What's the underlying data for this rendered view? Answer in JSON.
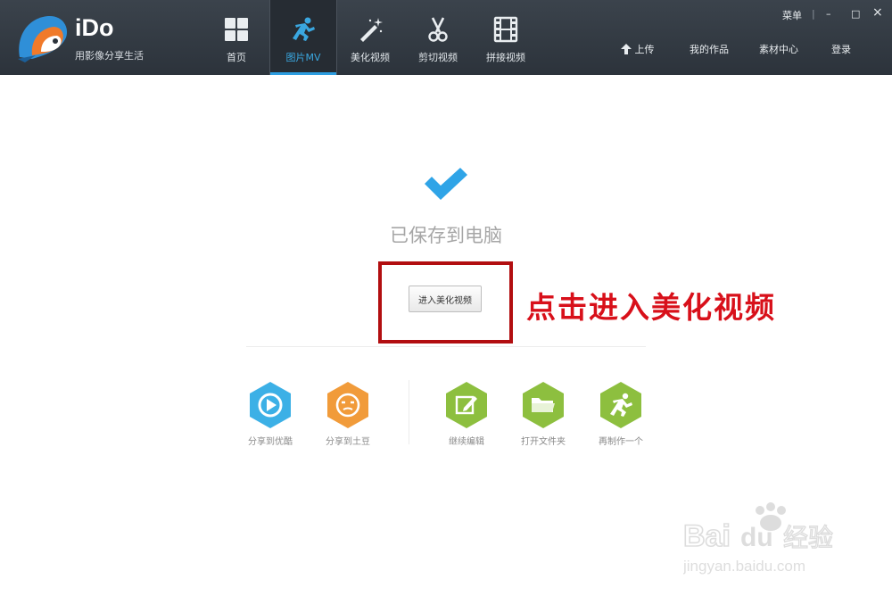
{
  "app": {
    "name": "iDo",
    "slogan": "用影像分享生活"
  },
  "nav": [
    {
      "label": "首页",
      "icon": "grid-icon",
      "active": false
    },
    {
      "label": "图片MV",
      "icon": "running-man-icon",
      "active": true
    },
    {
      "label": "美化视频",
      "icon": "magic-wand-icon",
      "active": false
    },
    {
      "label": "剪切视频",
      "icon": "scissors-icon",
      "active": false
    },
    {
      "label": "拼接视频",
      "icon": "film-strip-icon",
      "active": false
    }
  ],
  "window": {
    "menu": "菜单",
    "minimize": "–",
    "maximize": "□",
    "close": "×"
  },
  "right_nav": {
    "upload": "上传",
    "my_works": "我的作品",
    "materials": "素材中心",
    "login": "登录"
  },
  "main": {
    "saved_text": "已保存到电脑",
    "enter_button": "进入美化视频"
  },
  "annotation": "点击进入美化视频",
  "actions": [
    {
      "label": "分享到优酷",
      "icon": "youku-icon",
      "color": "#3cb0e6"
    },
    {
      "label": "分享到土豆",
      "icon": "tudou-icon",
      "color": "#f19b3a"
    },
    {
      "label": "继续编辑",
      "icon": "edit-icon",
      "color": "#8dbf3f"
    },
    {
      "label": "打开文件夹",
      "icon": "folder-icon",
      "color": "#8dbf3f"
    },
    {
      "label": "再制作一个",
      "icon": "running-man-icon",
      "color": "#8dbf3f"
    }
  ],
  "colors": {
    "topbar": "#2f363e",
    "accent": "#2d9de0",
    "check": "#2fa4e7",
    "annotation": "#d8101a"
  },
  "watermark": {
    "brand": "Baidu经验",
    "url": "jingyan.baidu.com"
  }
}
